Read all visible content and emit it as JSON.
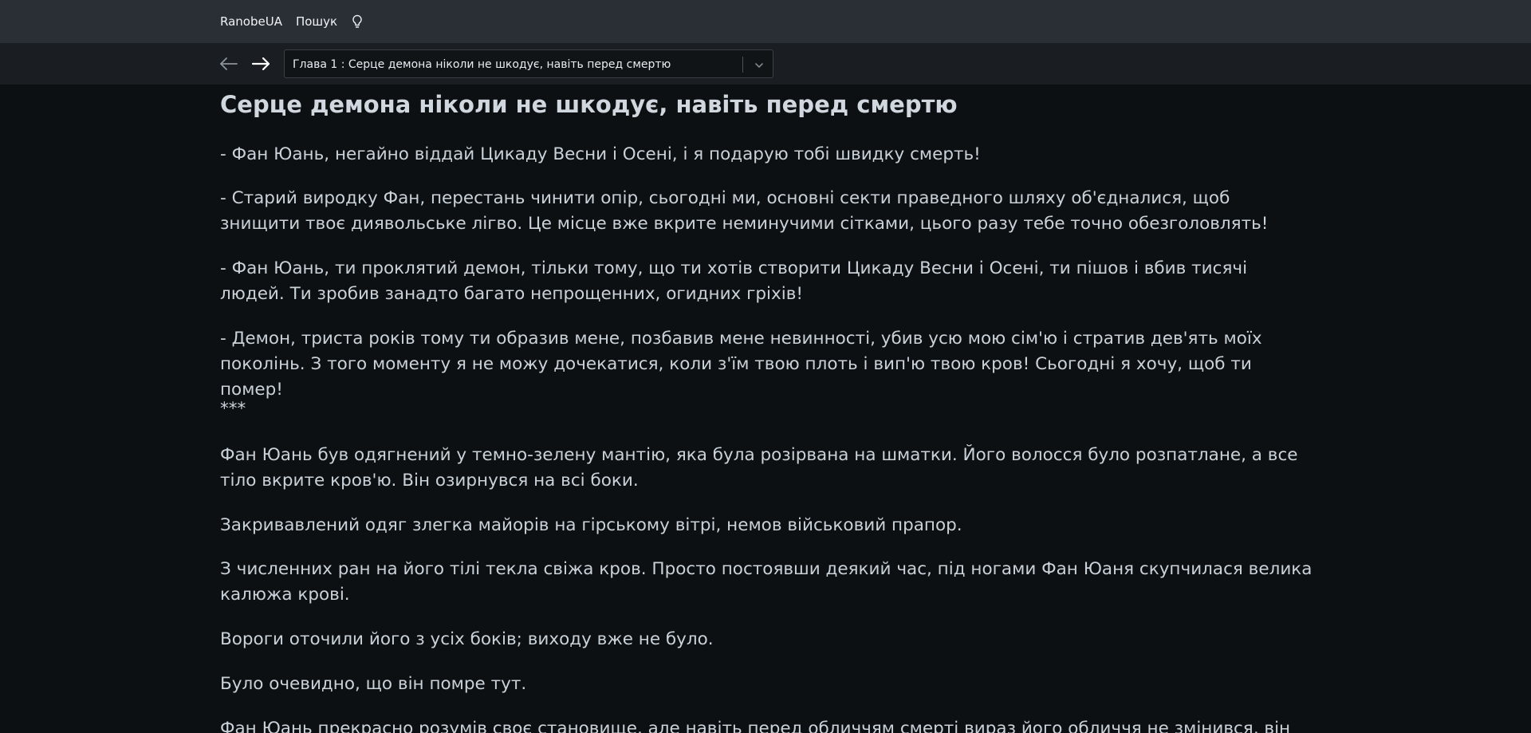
{
  "topbar": {
    "brand": "RanobeUA",
    "search_label": "Пошук",
    "theme_icon": "lightbulb-icon"
  },
  "chapterbar": {
    "prev_icon": "arrow-left-icon",
    "next_icon": "arrow-right-icon",
    "selected_chapter": "Глава 1 : Серце демона ніколи не шкодує, навіть перед смертю",
    "dropdown_icon": "chevron-down-icon"
  },
  "article": {
    "title": "Серце демона ніколи не шкодує, навіть перед смертю",
    "paragraphs": [
      "- Фан Юань, негайно віддай Цикаду Весни і Осені, і я подарую тобі швидку смерть!",
      "- Старий виродку Фан, перестань чинити опір, сьогодні ми, основні секти праведного шляху об'єдналися, щоб знищити твоє диявольське лігво. Це місце вже вкрите неминучими сітками, цього разу тебе точно обезголовлять!",
      "- Фан Юань, ти проклятий демон, тільки тому, що ти хотів створити Цикаду Весни і Осені, ти пішов і вбив тисячі людей. Ти зробив занадто багато непрощенних, огидних гріхів!",
      "- Демон, триста років тому ти образив мене, позбавив мене невинності, убив усю мою сім'ю і стратив дев'ять моїх поколінь. З того моменту я не можу дочекатися, коли з'їм твою плоть і вип'ю твою кров! Сьогодні я хочу, щоб ти помер!",
      "***",
      "Фан Юань був одягнений у темно-зелену мантію, яка була розірвана на шматки. Його волосся було розпатлане, а все тіло вкрите кров'ю. Він озирнувся на всі боки.",
      "Закривавлений одяг злегка майорів на гірському вітрі, немов військовий прапор.",
      "З численних ран на його тілі текла свіжа кров. Просто постоявши деякий час, під ногами Фан Юаня скупчилася велика калюжа крові.",
      "Вороги оточили його з усіх боків; виходу вже не було.",
      "Було очевидно, що він помре тут.",
      "Фан Юань прекрасно розумів своє становище, але навіть перед обличчям смерті вираз його обличчя не змінився, він був"
    ]
  }
}
